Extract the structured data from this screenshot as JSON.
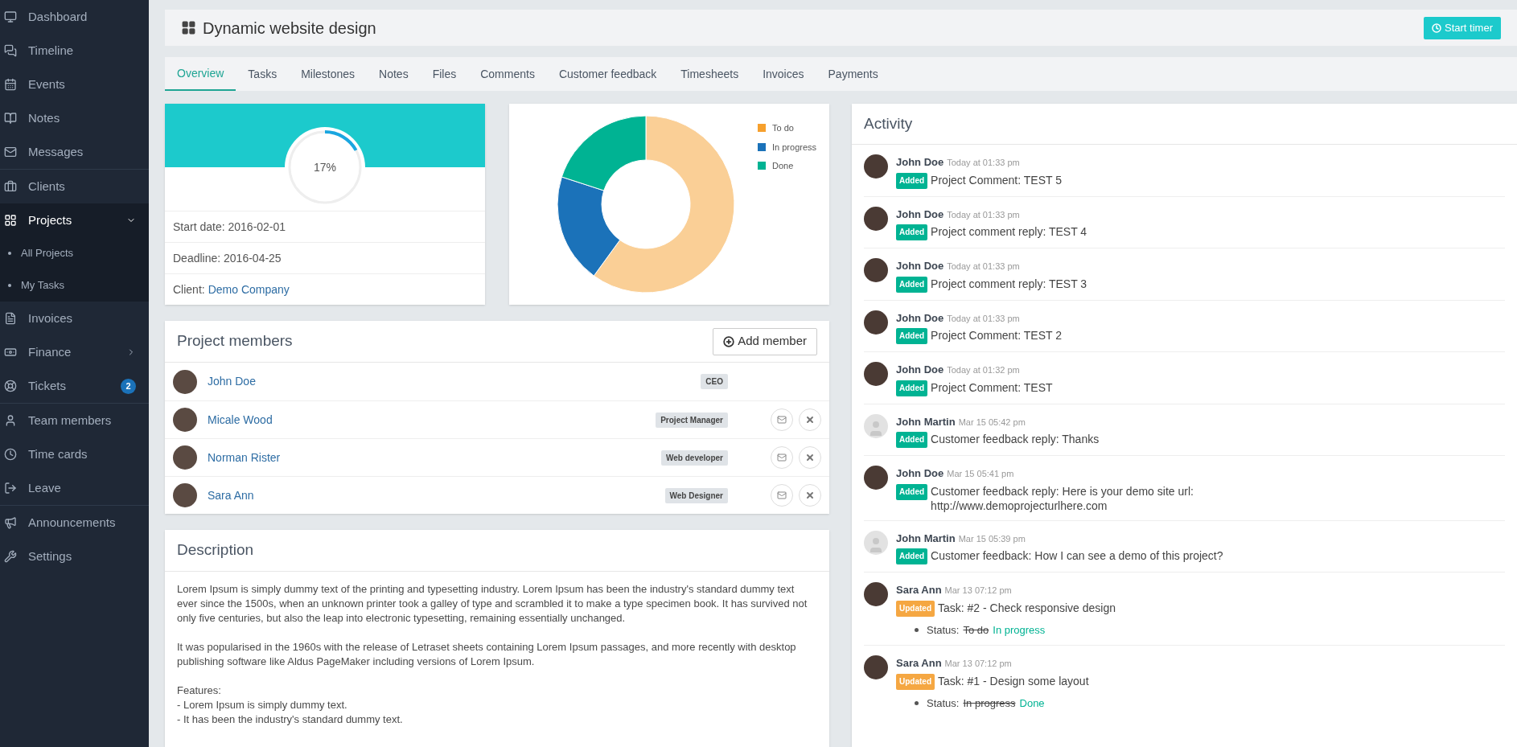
{
  "sidebar": {
    "sections": [
      {
        "items": [
          {
            "label": "Dashboard",
            "selected": false
          },
          {
            "label": "Timeline",
            "selected": false
          },
          {
            "label": "Events",
            "selected": false
          },
          {
            "label": "Notes",
            "selected": false
          },
          {
            "label": "Messages",
            "selected": false
          }
        ]
      },
      {
        "items": [
          {
            "label": "Clients",
            "selected": false
          },
          {
            "label": "Projects",
            "selected": true,
            "expanded": true,
            "children": [
              {
                "label": "All Projects"
              },
              {
                "label": "My Tasks"
              }
            ]
          },
          {
            "label": "Invoices",
            "selected": false
          },
          {
            "label": "Finance",
            "selected": false,
            "expanded": false
          },
          {
            "label": "Tickets",
            "selected": false,
            "badge": "2"
          }
        ]
      },
      {
        "items": [
          {
            "label": "Team members",
            "selected": false
          },
          {
            "label": "Time cards",
            "selected": false
          },
          {
            "label": "Leave",
            "selected": false
          }
        ]
      },
      {
        "items": [
          {
            "label": "Announcements",
            "selected": false
          },
          {
            "label": "Settings",
            "selected": false
          }
        ]
      }
    ]
  },
  "page": {
    "title": "Dynamic website design",
    "timer_button": "Start timer"
  },
  "tabs": [
    {
      "label": "Overview",
      "selected": true
    },
    {
      "label": "Tasks",
      "selected": false
    },
    {
      "label": "Milestones",
      "selected": false
    },
    {
      "label": "Notes",
      "selected": false
    },
    {
      "label": "Files",
      "selected": false
    },
    {
      "label": "Comments",
      "selected": false
    },
    {
      "label": "Customer feedback",
      "selected": false
    },
    {
      "label": "Timesheets",
      "selected": false
    },
    {
      "label": "Invoices",
      "selected": false
    },
    {
      "label": "Payments",
      "selected": false
    }
  ],
  "progress": {
    "level": 0.17,
    "label": "17%",
    "start_date": "Start date: 2016-02-01",
    "deadline": "Deadline: 2016-04-25",
    "client_label": "Client:",
    "client": "Demo Company"
  },
  "status_chart": {
    "legend": [
      {
        "label": "To do",
        "color": "#f6a02d"
      },
      {
        "label": "In progress",
        "color": "#1b72b9"
      },
      {
        "label": "Done",
        "color": "#00b393"
      }
    ]
  },
  "members": {
    "title": "Project members",
    "add_button": "Add member",
    "rows": [
      {
        "name": "John Doe",
        "role": "CEO",
        "removable": false
      },
      {
        "name": "Micale Wood",
        "role": "Project Manager",
        "removable": true
      },
      {
        "name": "Norman Rister",
        "role": "Web developer",
        "removable": true
      },
      {
        "name": "Sara Ann",
        "role": "Web Designer",
        "removable": true
      }
    ]
  },
  "description": {
    "title": "Description",
    "paragraphs": [
      "Lorem Ipsum is simply dummy text of the printing and typesetting industry. Lorem Ipsum has been the industry's standard dummy text ever since the 1500s, when an unknown printer took a galley of type and scrambled it to make a type specimen book. It has survived not only five centuries, but also the leap into electronic typesetting, remaining essentially unchanged.",
      "It was popularised in the 1960s with the release of Letraset sheets containing Lorem Ipsum passages, and more recently with desktop publishing software like Aldus PageMaker including versions of Lorem Ipsum."
    ],
    "features_title": "Features:",
    "features": [
      "- Lorem Ipsum is simply dummy text.",
      "- It has been the industry's standard dummy text."
    ]
  },
  "activity": {
    "title": "Activity",
    "items": [
      {
        "has_photo": true,
        "name": "John Doe",
        "time": "Today at 01:33 pm",
        "badge": "Added",
        "kind": "added",
        "text": "Project Comment: TEST 5"
      },
      {
        "has_photo": true,
        "name": "John Doe",
        "time": "Today at 01:33 pm",
        "badge": "Added",
        "kind": "added",
        "text": "Project comment reply: TEST 4"
      },
      {
        "has_photo": true,
        "name": "John Doe",
        "time": "Today at 01:33 pm",
        "badge": "Added",
        "kind": "added",
        "text": "Project comment reply: TEST 3"
      },
      {
        "has_photo": true,
        "name": "John Doe",
        "time": "Today at 01:33 pm",
        "badge": "Added",
        "kind": "added",
        "text": "Project Comment: TEST 2"
      },
      {
        "has_photo": true,
        "name": "John Doe",
        "time": "Today at 01:32 pm",
        "badge": "Added",
        "kind": "added",
        "text": "Project Comment: TEST"
      },
      {
        "has_photo": false,
        "name": "John Martin",
        "time": "Mar 15 05:42 pm",
        "badge": "Added",
        "kind": "added",
        "text": "Customer feedback reply: Thanks"
      },
      {
        "has_photo": true,
        "name": "John Doe",
        "time": "Mar 15 05:41 pm",
        "badge": "Added",
        "kind": "added",
        "text": "Customer feedback reply: Here is your demo site url: http://www.demoprojecturlhere.com"
      },
      {
        "has_photo": false,
        "name": "John Martin",
        "time": "Mar 15 05:39 pm",
        "badge": "Added",
        "kind": "added",
        "text": "Customer feedback: How I can see a demo of this project?"
      },
      {
        "has_photo": true,
        "name": "Sara Ann",
        "time": "Mar 13 07:12 pm",
        "badge": "Updated",
        "kind": "updated",
        "text": "Task: #2 - Check responsive design",
        "status": {
          "label": "Status:",
          "old": "To do",
          "new": "In progress"
        }
      },
      {
        "has_photo": true,
        "name": "Sara Ann",
        "time": "Mar 13 07:12 pm",
        "badge": "Updated",
        "kind": "updated",
        "text": "Task: #1 - Design some layout",
        "status": {
          "label": "Status:",
          "old": "In progress",
          "new": "Done"
        }
      }
    ]
  }
}
